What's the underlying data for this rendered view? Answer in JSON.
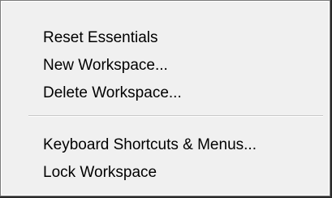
{
  "menu": {
    "group_1": [
      {
        "label": "Reset Essentials"
      },
      {
        "label": "New Workspace..."
      },
      {
        "label": "Delete Workspace..."
      }
    ],
    "group_2": [
      {
        "label": "Keyboard Shortcuts & Menus..."
      },
      {
        "label": "Lock Workspace"
      }
    ]
  },
  "colors": {
    "menu_background": "#f0f0f0",
    "menu_border": "#7a7a7a",
    "text": "#000000",
    "separator": "#c8c8c8",
    "outer_background": "#2b2b2b"
  }
}
